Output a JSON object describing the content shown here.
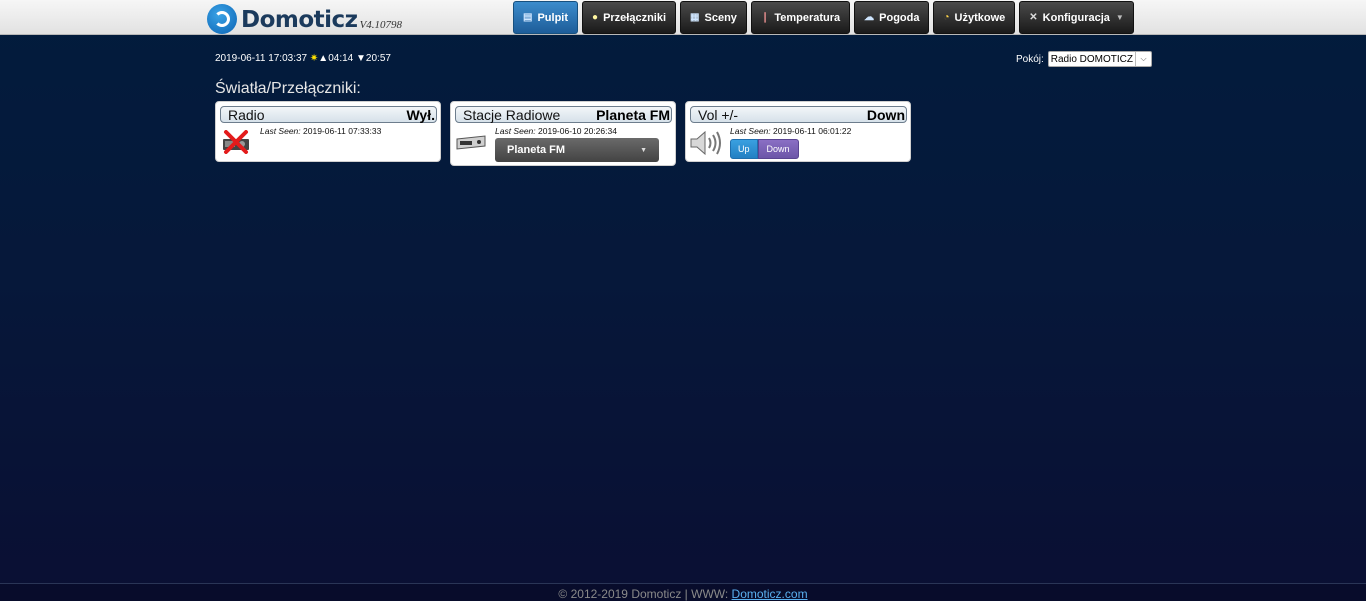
{
  "brand": {
    "name": "Domoticz",
    "version": "V4.10798"
  },
  "nav": {
    "items": [
      {
        "label": "Pulpit",
        "icon": "dashboard-icon",
        "active": true
      },
      {
        "label": "Przełączniki",
        "icon": "lightbulb-icon"
      },
      {
        "label": "Sceny",
        "icon": "scene-icon"
      },
      {
        "label": "Temperatura",
        "icon": "thermometer-icon"
      },
      {
        "label": "Pogoda",
        "icon": "cloud-icon"
      },
      {
        "label": "Użytkowe",
        "icon": "utility-icon"
      },
      {
        "label": "Konfiguracja",
        "icon": "tools-icon"
      }
    ]
  },
  "status": {
    "datetime": "2019-06-11 17:03:37",
    "sunrise": "04:14",
    "sunset": "20:57"
  },
  "room": {
    "label": "Pokój:",
    "selected": "Radio DOMOTICZ"
  },
  "section_title": "Światła/Przełączniki:",
  "devices": [
    {
      "name": "Radio",
      "status": "Wył.",
      "last_seen_label": "Last Seen:",
      "last_seen": "2019-06-11 07:33:33"
    },
    {
      "name": "Stacje Radiowe",
      "status": "Planeta FM",
      "last_seen_label": "Last Seen:",
      "last_seen": "2019-06-10 20:26:34",
      "selector_value": "Planeta FM"
    },
    {
      "name": "Vol +/-",
      "status": "Down",
      "last_seen_label": "Last Seen:",
      "last_seen": "2019-06-11 06:01:22",
      "btn_up": "Up",
      "btn_down": "Down"
    }
  ],
  "footer": {
    "text": "© 2012-2019 Domoticz | WWW: ",
    "link": "Domoticz.com"
  }
}
